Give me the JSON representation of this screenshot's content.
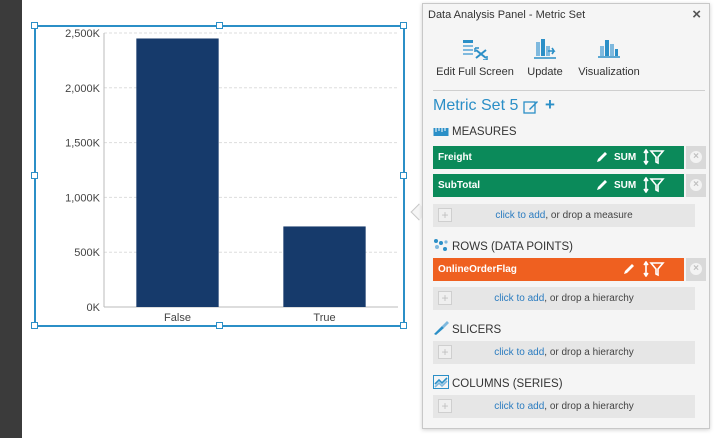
{
  "chart": {
    "frame_color": "#2b8fc7",
    "bar_color": "#163a6b"
  },
  "chart_data": {
    "type": "bar",
    "categories": [
      "False",
      "True"
    ],
    "values": [
      2450,
      735
    ],
    "ylim": [
      0,
      2500
    ],
    "yticks": [
      0,
      500,
      1000,
      1500,
      2000,
      2500
    ],
    "ytick_labels": [
      "0K",
      "500K",
      "1,000K",
      "1,500K",
      "2,000K",
      "2,500K"
    ],
    "grid": true
  },
  "panel": {
    "title": "Data Analysis Panel - Metric Set",
    "close_glyph": "×",
    "toolbar": {
      "edit_full_screen": "Edit Full Screen",
      "update": "Update",
      "visualization": "Visualization"
    },
    "metric_set_name": "Metric Set 5",
    "add_glyph": "+",
    "measures": {
      "header": "MEASURES",
      "items": [
        {
          "name": "Freight",
          "aggregation": "SUM"
        },
        {
          "name": "SubTotal",
          "aggregation": "SUM"
        }
      ],
      "drop_link": "click to add",
      "drop_rest": ", or drop a measure"
    },
    "rows": {
      "header": "ROWS (DATA POINTS)",
      "items": [
        {
          "name": "OnlineOrderFlag"
        }
      ],
      "drop_link": "click to add",
      "drop_rest": ", or drop a hierarchy"
    },
    "slicers": {
      "header": "SLICERS",
      "drop_link": "click to add",
      "drop_rest": ", or drop a hierarchy"
    },
    "columns": {
      "header": "COLUMNS (SERIES)",
      "drop_link": "click to add",
      "drop_rest": ", or drop a hierarchy"
    },
    "colors": {
      "accent": "#2b8fc7",
      "measure": "#0b8a5a",
      "row": "#ef6020"
    }
  }
}
